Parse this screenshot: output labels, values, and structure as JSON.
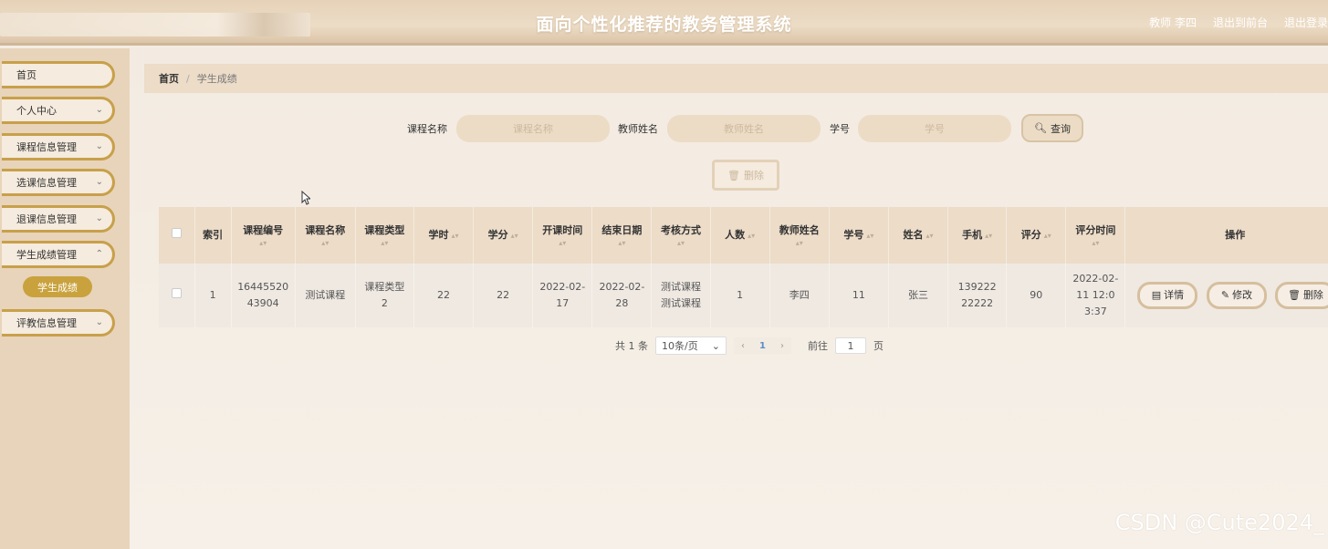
{
  "header": {
    "title": "面向个性化推荐的教务管理系统",
    "user_label": "教师 李四",
    "back_label": "退出到前台",
    "logout_label": "退出登录"
  },
  "sidebar": {
    "items": [
      {
        "label": "首页",
        "has_chevron": false
      },
      {
        "label": "个人中心",
        "has_chevron": true
      },
      {
        "label": "课程信息管理",
        "has_chevron": true
      },
      {
        "label": "选课信息管理",
        "has_chevron": true
      },
      {
        "label": "退课信息管理",
        "has_chevron": true
      },
      {
        "label": "学生成绩管理",
        "has_chevron": true
      },
      {
        "label": "评教信息管理",
        "has_chevron": true
      }
    ],
    "active_sub": "学生成绩"
  },
  "breadcrumb": {
    "home": "首页",
    "separator": "/",
    "current": "学生成绩"
  },
  "search": {
    "course_label": "课程名称",
    "course_placeholder": "课程名称",
    "teacher_label": "教师姓名",
    "teacher_placeholder": "教师姓名",
    "student_label": "学号",
    "student_placeholder": "学号",
    "query_label": "查询"
  },
  "toolbar": {
    "delete_label": "删除"
  },
  "table": {
    "columns": [
      "索引",
      "课程编号",
      "课程名称",
      "课程类型",
      "学时",
      "学分",
      "开课时间",
      "结束日期",
      "考核方式",
      "人数",
      "教师姓名",
      "学号",
      "姓名",
      "手机",
      "评分",
      "评分时间",
      "操作"
    ],
    "rows": [
      {
        "index": "1",
        "course_id": "1644552043904",
        "course_name": "测试课程",
        "course_type": "课程类型2",
        "hours": "22",
        "credits": "22",
        "start": "2022-02-17",
        "end": "2022-02-28",
        "exam": "测试课程测试课程",
        "count": "1",
        "teacher": "李四",
        "student_no": "11",
        "name": "张三",
        "phone": "13922222222",
        "score": "90",
        "score_time": "2022-02-11 12:03:37"
      }
    ],
    "actions": {
      "detail": "详情",
      "edit": "修改",
      "delete": "删除"
    }
  },
  "pagination": {
    "total": "共 1 条",
    "page_size": "10条/页",
    "current_page": "1",
    "goto_prefix": "前往",
    "goto_value": "1",
    "goto_suffix": "页"
  },
  "watermark": "CSDN @Cute2024_",
  "colors": {
    "accent": "#c9a23e",
    "header": "#e6d2b8",
    "sidebar": "#e8d4bb",
    "table_header": "#ecdcc8"
  }
}
